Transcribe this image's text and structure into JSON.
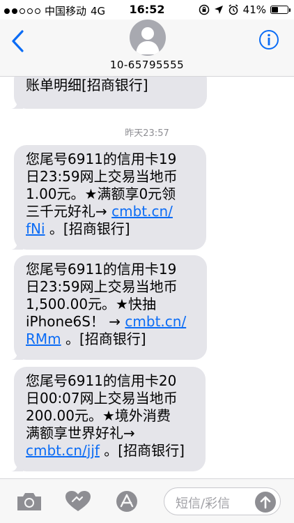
{
  "status_bar": {
    "carrier": "中国移动",
    "network": "4G",
    "time": "16:52",
    "battery_percent": "41%",
    "battery_level": 0.41
  },
  "header": {
    "contact": "10-65795555"
  },
  "thread": {
    "partial_message": "账单明细[招商银行]",
    "timestamp": "昨天23:57",
    "messages": [
      {
        "lines": [
          "您尾号6911的信用卡19",
          "日23:59网上交易当地币",
          "1.00元。★满额享0元领",
          "三千元好礼→ "
        ],
        "link1": "cmbt.cn/",
        "link2": "fNi",
        "suffix": " 。[招商银行]"
      },
      {
        "lines": [
          "您尾号6911的信用卡19",
          "日23:59网上交易当地币",
          "1,500.00元。★快抽",
          "iPhone6S！ → "
        ],
        "link1": "cmbt.cn/",
        "link2": "RMm",
        "suffix": " 。[招商银行]"
      },
      {
        "lines": [
          "您尾号6911的信用卡20",
          "日00:07网上交易当地币",
          "200.00元。★境外消费",
          "满额享世界好礼→"
        ],
        "link2": "cmbt.cn/jjf",
        "suffix": " 。[招商银行]"
      }
    ]
  },
  "input_bar": {
    "placeholder": "短信/彩信"
  },
  "colors": {
    "accent": "#0b6cf5",
    "bubble": "#e5e5ea",
    "link": "#0b6cf5"
  }
}
